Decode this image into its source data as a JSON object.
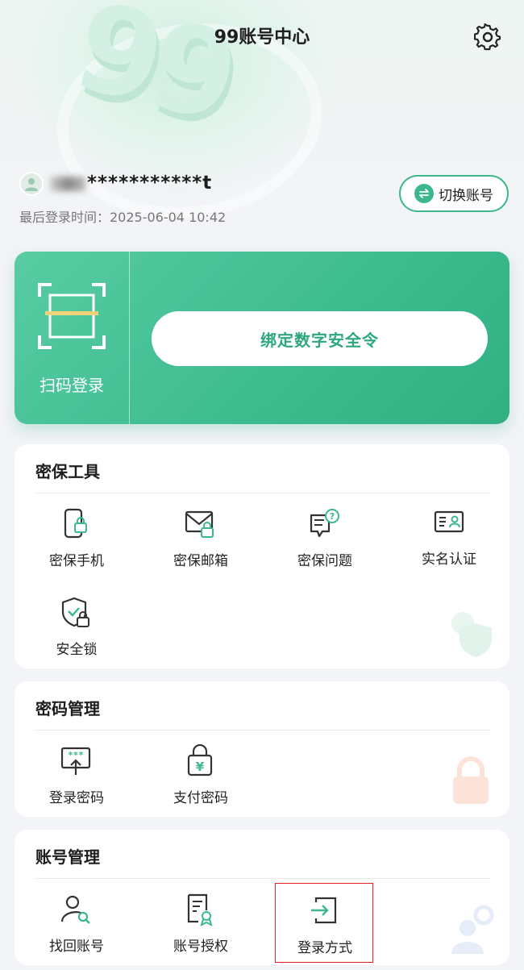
{
  "header": {
    "title": "99账号中心",
    "account_masked": "***********t",
    "last_login": "最后登录时间：2025-06-04 10:42",
    "switch_label": "切换账号",
    "bg_decoration": "99"
  },
  "quick": {
    "scan_label": "扫码登录",
    "bind_label": "绑定数字安全令"
  },
  "sections": {
    "security_tools": {
      "title": "密保工具",
      "items": [
        {
          "label": "密保手机",
          "icon": "phone-lock-icon"
        },
        {
          "label": "密保邮箱",
          "icon": "mail-lock-icon"
        },
        {
          "label": "密保问题",
          "icon": "question-icon"
        },
        {
          "label": "实名认证",
          "icon": "id-card-icon"
        },
        {
          "label": "安全锁",
          "icon": "shield-lock-icon"
        }
      ]
    },
    "password": {
      "title": "密码管理",
      "items": [
        {
          "label": "登录密码",
          "icon": "password-screen-icon"
        },
        {
          "label": "支付密码",
          "icon": "yuan-lock-icon"
        }
      ]
    },
    "account": {
      "title": "账号管理",
      "items": [
        {
          "label": "找回账号",
          "icon": "user-search-icon"
        },
        {
          "label": "账号授权",
          "icon": "document-badge-icon"
        },
        {
          "label": "登录方式",
          "icon": "login-arrow-icon"
        }
      ]
    }
  },
  "colors": {
    "accent": "#3bb88c",
    "accent_dark": "#2fa77d",
    "highlight": "#e02020"
  }
}
